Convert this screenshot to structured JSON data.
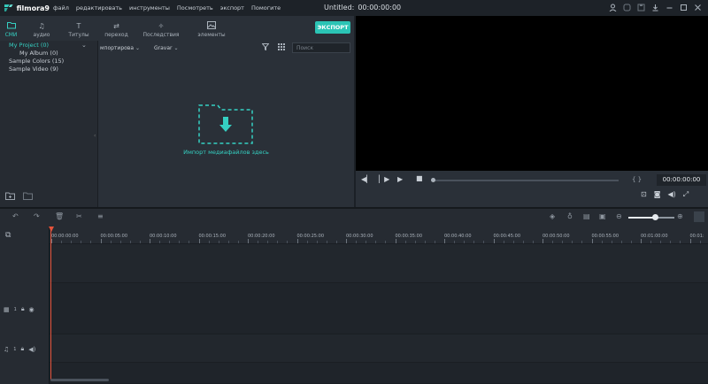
{
  "app": {
    "logo_text": "filmora9",
    "window_title": "Untitled:",
    "window_timecode": "00:00:00:00"
  },
  "menu": [
    "файл",
    "редактировать",
    "инструменты",
    "Посмотреть",
    "экспорт",
    "Помогите"
  ],
  "title_icons": [
    "user-icon",
    "cart-icon",
    "save-icon",
    "download-icon",
    "minimize-icon",
    "maximize-icon",
    "close-icon"
  ],
  "library_tabs": [
    {
      "label": "СМИ",
      "icon": "folder-icon",
      "active": true
    },
    {
      "label": "аудио",
      "icon": "music-note-icon",
      "active": false
    },
    {
      "label": "Титулы",
      "icon": "text-icon",
      "active": false
    },
    {
      "label": "переход",
      "icon": "transition-icon",
      "active": false
    },
    {
      "label": "Последствия",
      "icon": "effects-icon",
      "active": false
    },
    {
      "label": "элементы",
      "icon": "image-icon",
      "active": false
    }
  ],
  "export_label": "ЭКСПОРТ",
  "tree": [
    {
      "label": "My Project (0)",
      "selected": true
    },
    {
      "label": "My Album (0)",
      "selected": false
    },
    {
      "label": "Sample Colors (15)",
      "selected": false
    },
    {
      "label": "Sample Video (9)",
      "selected": false
    }
  ],
  "media": {
    "filter_import": "мпортирова",
    "filter_sort": "Gravar",
    "search_placeholder": "Поиск",
    "import_text": "Импорт медиафайлов здесь"
  },
  "player": {
    "timecode": "00:00:00:00",
    "braces": "{ }"
  },
  "timeline": {
    "ruler_labels": [
      "00:00:00:00",
      "00:00:05:00",
      "00:00:10:00",
      "00:00:15:00",
      "00:00:20:00",
      "00:00:25:00",
      "00:00:30:00",
      "00:00:35:00",
      "00:00:40:00",
      "00:00:45:00",
      "00:00:50:00",
      "00:00:55:00",
      "00:01:00:00",
      "00:01:"
    ],
    "video_track_num": "1",
    "audio_track_num": "1"
  },
  "colors": {
    "accent": "#35d0c2",
    "export_button": "#2bc4b5",
    "playhead": "#e5533b",
    "background": "#1b2026"
  }
}
